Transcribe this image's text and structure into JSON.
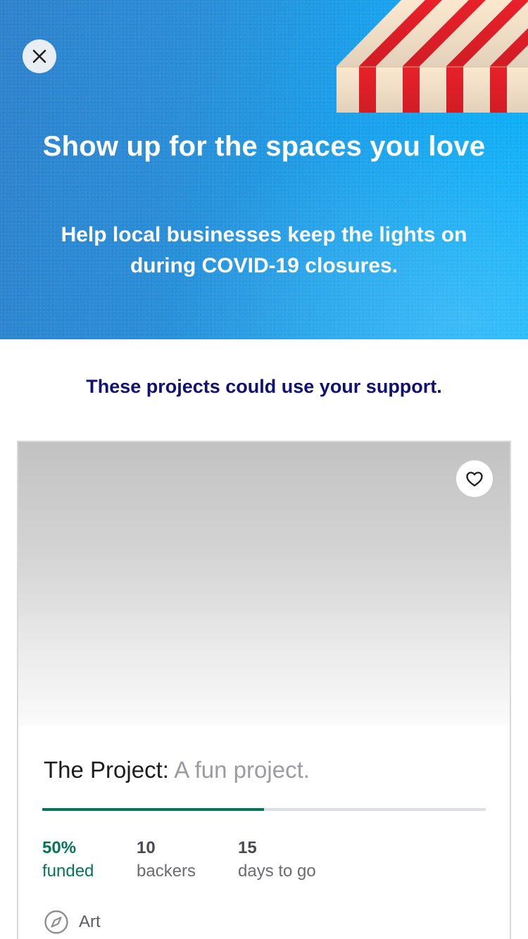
{
  "header": {
    "close_icon": "close-icon",
    "title": "Show up for the spaces you love",
    "subtitle": "Help local businesses keep the lights on during COVID-19 closures.",
    "awning_icon": "storefront-awning-illustration",
    "colors": {
      "background_start": "#2f83cc",
      "background_end": "#0cb3fb",
      "awning_red": "#e8202a",
      "awning_cream": "#fbe8cf",
      "text": "#ffffff"
    }
  },
  "section": {
    "prompt": "These projects could use your support."
  },
  "project_card": {
    "save_icon": "heart-icon",
    "name": "The Project:",
    "blurb": "A fun project.",
    "progress_fraction": 0.5,
    "stats": {
      "funded_value": "50%",
      "funded_label": "funded",
      "backers_value": "10",
      "backers_label": "backers",
      "days_value": "15",
      "days_label": "days to go"
    },
    "category_icon": "compass-icon",
    "category": "Art",
    "colors": {
      "accent_green": "#067457",
      "progress_track": "#dcdee5"
    }
  }
}
